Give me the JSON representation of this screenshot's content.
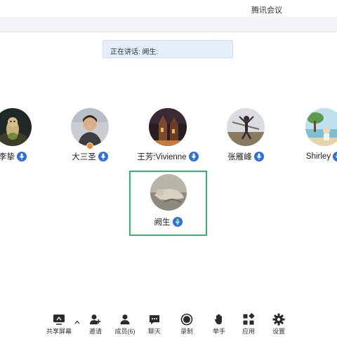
{
  "window": {
    "title": "腾讯会议"
  },
  "speaking": {
    "text": "正在讲话: 阙生:"
  },
  "participants": [
    {
      "name": "李挚",
      "avatar": "ghibli-character-avatar",
      "mic": "mic-icon"
    },
    {
      "name": "大三圣",
      "avatar": "person-photo-avatar",
      "mic": "mic-icon",
      "badge": "orange-status-badge"
    },
    {
      "name": "王芳🕯Vivienne",
      "avatar": "church-night-avatar",
      "mic": "mic-icon"
    },
    {
      "name": "张雁峰",
      "avatar": "jumping-person-avatar",
      "mic": "mic-icon"
    },
    {
      "name": "Shirley",
      "avatar": "beach-scene-avatar",
      "mic": "mic-icon"
    }
  ],
  "active_speaker": {
    "name": "阙生",
    "avatar": "hand-photo-avatar",
    "mic": "mic-speaking-icon"
  },
  "toolbar": {
    "items": [
      {
        "label": "共享屏幕",
        "icon": "share-screen-icon"
      },
      {
        "label": "邀请",
        "icon": "invite-icon"
      },
      {
        "label": "成员(6)",
        "icon": "members-icon"
      },
      {
        "label": "聊天",
        "icon": "chat-icon"
      },
      {
        "label": "录制",
        "icon": "record-icon"
      },
      {
        "label": "举手",
        "icon": "raise-hand-icon"
      },
      {
        "label": "应用",
        "icon": "apps-icon"
      },
      {
        "label": "设置",
        "icon": "settings-icon"
      }
    ]
  },
  "colors": {
    "accent": "#2f6fd6",
    "active_border": "#35b56b",
    "banner": "#e5eefb",
    "badge": "#f0872f"
  }
}
